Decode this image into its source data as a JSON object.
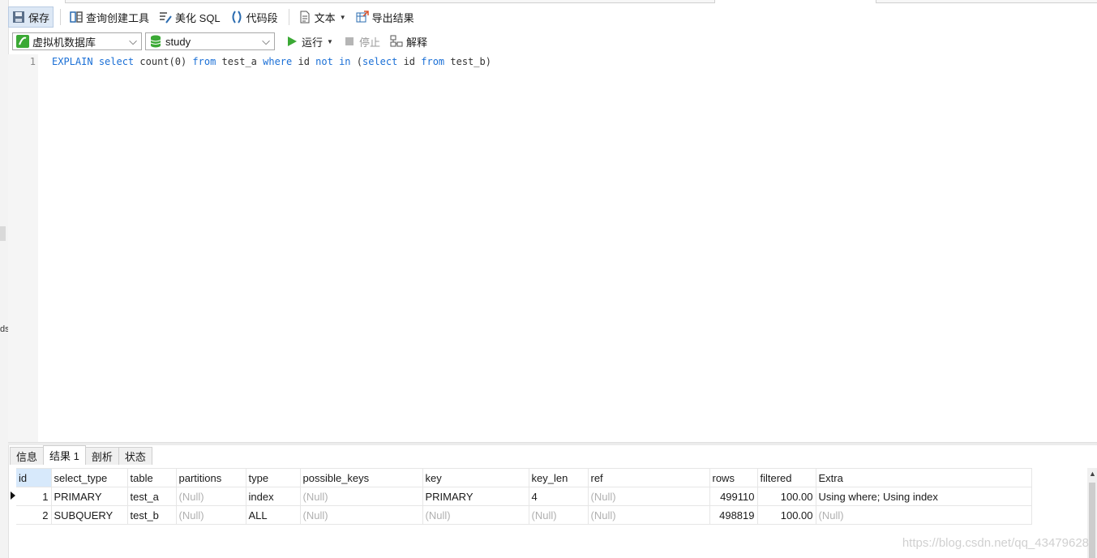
{
  "toolbar_top": {
    "save": "保存",
    "query_builder": "查询创建工具",
    "beautify_sql": "美化 SQL",
    "code_snippet": "代码段",
    "text": "文本",
    "export_results": "导出结果"
  },
  "toolbar_run": {
    "connection": "虚拟机数据库",
    "database": "study",
    "run": "运行",
    "stop": "停止",
    "explain": "解释"
  },
  "editor": {
    "line_number": "1",
    "tokens": [
      {
        "t": "EXPLAIN",
        "k": "kw"
      },
      {
        "t": " "
      },
      {
        "t": "select",
        "k": "kw"
      },
      {
        "t": " count(0) "
      },
      {
        "t": "from",
        "k": "kw"
      },
      {
        "t": " test_a "
      },
      {
        "t": "where",
        "k": "kw"
      },
      {
        "t": " id "
      },
      {
        "t": "not",
        "k": "kw"
      },
      {
        "t": " "
      },
      {
        "t": "in",
        "k": "kw"
      },
      {
        "t": " ("
      },
      {
        "t": "select",
        "k": "kw"
      },
      {
        "t": " id "
      },
      {
        "t": "from",
        "k": "kw"
      },
      {
        "t": " test_b)"
      }
    ]
  },
  "result_tabs": [
    "信息",
    "结果 1",
    "剖析",
    "状态"
  ],
  "grid": {
    "columns": [
      "id",
      "select_type",
      "table",
      "partitions",
      "type",
      "possible_keys",
      "key",
      "key_len",
      "ref",
      "rows",
      "filtered",
      "Extra"
    ],
    "rows": [
      [
        "1",
        "PRIMARY",
        "test_a",
        "(Null)",
        "index",
        "(Null)",
        "PRIMARY",
        "4",
        "(Null)",
        "499110",
        "100.00",
        "Using where; Using index"
      ],
      [
        "2",
        "SUBQUERY",
        "test_b",
        "(Null)",
        "ALL",
        "(Null)",
        "(Null)",
        "(Null)",
        "(Null)",
        "498819",
        "100.00",
        "(Null)"
      ]
    ]
  },
  "left_strip_clip": "ds",
  "watermark": "https://blog.csdn.net/qq_43479628",
  "colors": {
    "keyword": "#1a6fd6",
    "null_text": "#b0b0b0",
    "run_green": "#3ba935",
    "id_header": "#d7e9fb"
  }
}
